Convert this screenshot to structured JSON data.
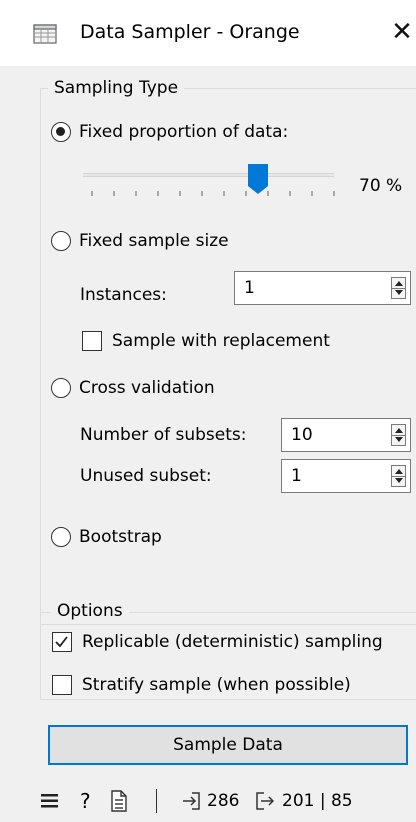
{
  "window": {
    "title": "Data Sampler - Orange",
    "close_glyph": "✕",
    "icon": "data-sampler-icon"
  },
  "sampling_type": {
    "group_title": "Sampling Type",
    "fixed_proportion": {
      "label": "Fixed proportion of data:",
      "selected": true,
      "slider_percent": 70,
      "value_text": "70 %"
    },
    "fixed_sample_size": {
      "label": "Fixed sample size",
      "selected": false,
      "instances_label": "Instances:",
      "instances_value": "1",
      "with_replacement_label": "Sample with replacement",
      "with_replacement_checked": false
    },
    "cross_validation": {
      "label": "Cross validation",
      "selected": false,
      "subsets_label": "Number of subsets:",
      "subsets_value": "10",
      "unused_label": "Unused subset:",
      "unused_value": "1"
    },
    "bootstrap": {
      "label": "Bootstrap",
      "selected": false
    }
  },
  "options": {
    "group_title": "Options",
    "replicable_label": "Replicable (deterministic) sampling",
    "replicable_checked": true,
    "stratify_label": "Stratify sample (when possible)",
    "stratify_checked": false
  },
  "sample_button_label": "Sample Data",
  "statusbar": {
    "menu_icon": "menu-icon",
    "help_icon": "help-icon",
    "report_icon": "report-icon",
    "input_count": "286",
    "output_count": "201 | 85"
  },
  "colors": {
    "accent": "#0078d7",
    "background": "#f0f0f0"
  }
}
